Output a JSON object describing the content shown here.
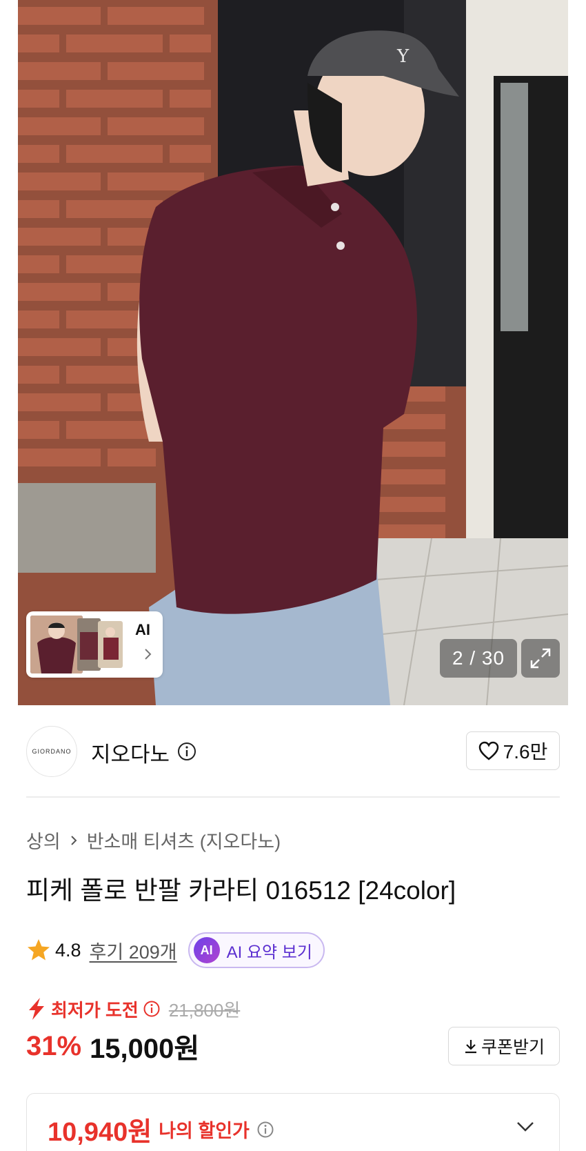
{
  "gallery": {
    "current": "2",
    "separator": "/",
    "total": "30",
    "counter_text": "2 / 30",
    "ai_label": "AI",
    "expand_icon": "expand-icon"
  },
  "brand": {
    "logo_text": "GIORDANO",
    "name": "지오다노",
    "likes": "7.6만"
  },
  "breadcrumb": {
    "items": [
      "상의",
      "반소매 티셔츠 (지오다노)"
    ]
  },
  "product": {
    "title": "피케 폴로 반팔 카라티 016512 [24color]",
    "rating": "4.8",
    "reviews": "후기 209개",
    "ai_badge": "AI",
    "ai_summary": "AI 요약 보기"
  },
  "pricing": {
    "promo_label": "최저가 도전",
    "original_price": "21,800원",
    "discount": "31%",
    "price": "15,000원",
    "coupon_label": "쿠폰받기",
    "my_price": "10,940원",
    "my_price_label": "나의 할인가"
  },
  "colors": {
    "accent_red": "#e8322b",
    "ai_purple": "#5b2fd0",
    "star": "#f5a623"
  }
}
